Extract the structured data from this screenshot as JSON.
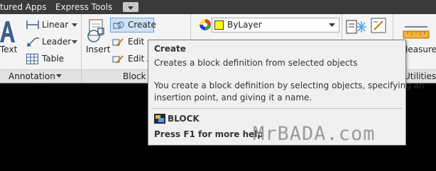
{
  "menu": {
    "item_featured": "tured Apps",
    "item_express": "Express Tools"
  },
  "annotation": {
    "text_label": "Text",
    "linear_label": "Linear",
    "leader_label": "Leader",
    "table_label": "Table",
    "panel_title": "Annotation"
  },
  "block": {
    "insert_label": "Insert",
    "create_label": "Create",
    "edit_label": "Edit",
    "edit_attr_label": "Edit A",
    "panel_title": "Block"
  },
  "properties": {
    "layer_value": "ByLayer",
    "swatch_color": "#ffff00"
  },
  "utilities": {
    "measure_label": "Measure",
    "panel_title": "Utilities"
  },
  "tooltip": {
    "title": "Create",
    "short_desc": "Creates a block definition from selected objects",
    "long_desc_1": "You create a block definition by selecting objects, specifying an",
    "long_desc_2": "insertion point, and giving it a name.",
    "command_name": "BLOCK",
    "help_text": "Press F1 for more help"
  },
  "watermark": "MrBADA.com",
  "icons": [
    "text-a-icon",
    "linear-dimension-icon",
    "leader-icon",
    "table-icon",
    "insert-block-icon",
    "create-block-icon",
    "edit-block-icon",
    "color-wheel-icon",
    "match-properties-icon",
    "measure-ruler-icon",
    "block-command-icon"
  ]
}
